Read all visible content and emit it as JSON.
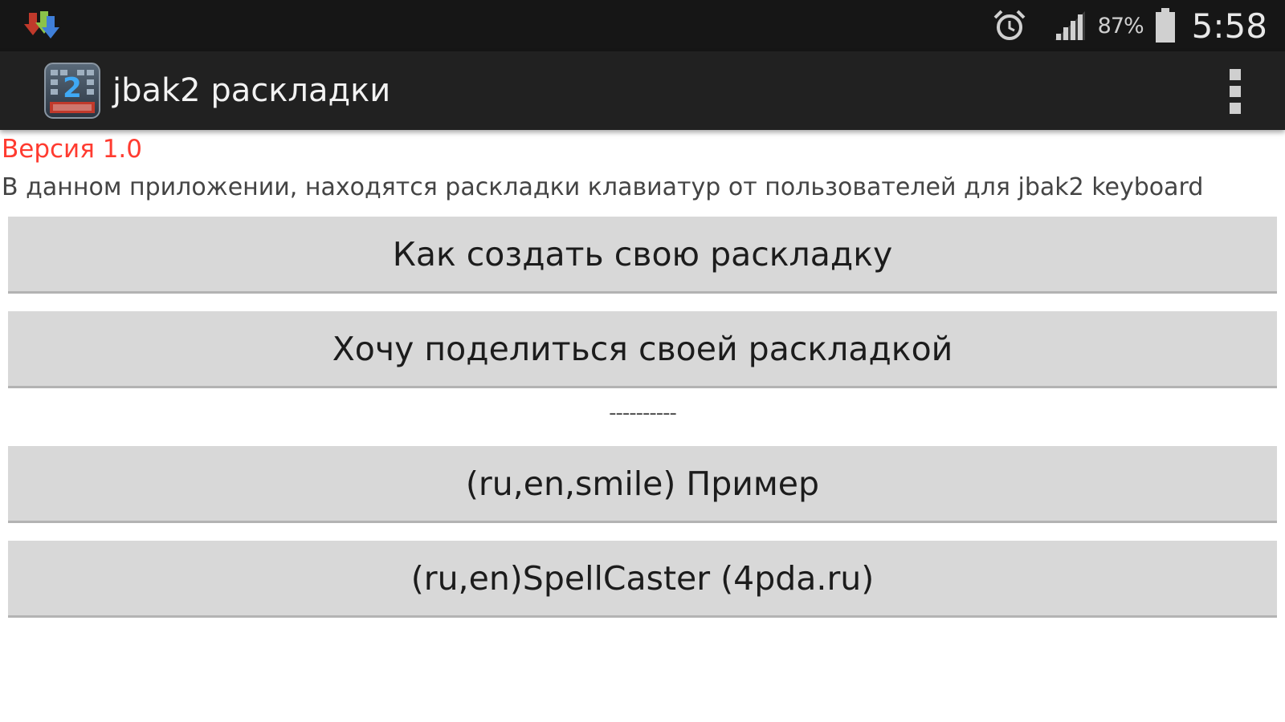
{
  "status_bar": {
    "notification_icon": "download-icon",
    "alarm_icon": "alarm-clock-icon",
    "signal_icon": "cell-signal-icon",
    "battery_percent": "87%",
    "battery_icon": "battery-icon",
    "time": "5:58"
  },
  "action_bar": {
    "app_icon": "jbak2-keyboard-icon",
    "title": "jbak2 раскладки",
    "menu_icon": "overflow-menu-icon"
  },
  "content": {
    "version": "Версия 1.0",
    "description": "В данном приложении, находятся раскладки клавиатур от пользователей для jbak2 keyboard",
    "buttons": [
      {
        "label": "Как создать свою раскладку"
      },
      {
        "label": "Хочу поделиться своей раскладкой"
      }
    ],
    "separator": "----------",
    "layout_buttons": [
      {
        "label": "(ru,en,smile) Пример"
      },
      {
        "label": "(ru,en)SpellCaster (4pda.ru)"
      }
    ]
  },
  "colors": {
    "status_bar_bg": "#161616",
    "action_bar_bg": "#212121",
    "version_text": "#ff3b30",
    "button_bg": "#d8d8d8"
  }
}
